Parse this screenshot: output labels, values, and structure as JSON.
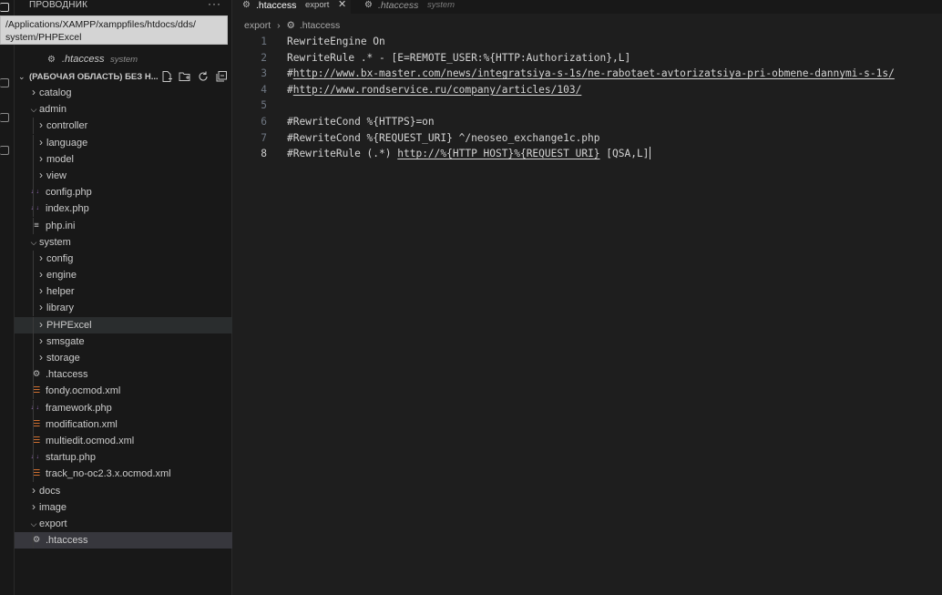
{
  "explorer": {
    "title": "ПРОВОДНИК",
    "more": "···",
    "tooltip_line1": "/Applications/XAMPP/xamppfiles/htdocs/dds/",
    "tooltip_line2": "system/PHPExcel",
    "open_editor_name": ".htaccess",
    "open_editor_desc": "system",
    "workspace_title": "(РАБОЧАЯ ОБЛАСТЬ) БЕЗ Н...",
    "tree": [
      {
        "label": "catalog",
        "kind": "folder",
        "expanded": false,
        "depth": 1
      },
      {
        "label": "admin",
        "kind": "folder",
        "expanded": true,
        "depth": 1
      },
      {
        "label": "controller",
        "kind": "folder",
        "expanded": false,
        "depth": 2
      },
      {
        "label": "language",
        "kind": "folder",
        "expanded": false,
        "depth": 2
      },
      {
        "label": "model",
        "kind": "folder",
        "expanded": false,
        "depth": 2
      },
      {
        "label": "view",
        "kind": "folder",
        "expanded": false,
        "depth": 2
      },
      {
        "label": "config.php",
        "kind": "php",
        "depth": 2
      },
      {
        "label": "index.php",
        "kind": "php",
        "depth": 2
      },
      {
        "label": "php.ini",
        "kind": "ini",
        "depth": 2
      },
      {
        "label": "system",
        "kind": "folder",
        "expanded": true,
        "depth": 1
      },
      {
        "label": "config",
        "kind": "folder",
        "expanded": false,
        "depth": 2
      },
      {
        "label": "engine",
        "kind": "folder",
        "expanded": false,
        "depth": 2
      },
      {
        "label": "helper",
        "kind": "folder",
        "expanded": false,
        "depth": 2
      },
      {
        "label": "library",
        "kind": "folder",
        "expanded": false,
        "depth": 2
      },
      {
        "label": "PHPExcel",
        "kind": "folder",
        "expanded": false,
        "depth": 2,
        "state": "hover"
      },
      {
        "label": "smsgate",
        "kind": "folder",
        "expanded": false,
        "depth": 2
      },
      {
        "label": "storage",
        "kind": "folder",
        "expanded": false,
        "depth": 2
      },
      {
        "label": ".htaccess",
        "kind": "gear",
        "depth": 2
      },
      {
        "label": "fondy.ocmod.xml",
        "kind": "xml",
        "depth": 2
      },
      {
        "label": "framework.php",
        "kind": "php",
        "depth": 2
      },
      {
        "label": "modification.xml",
        "kind": "xml",
        "depth": 2
      },
      {
        "label": "multiedit.ocmod.xml",
        "kind": "xml",
        "depth": 2
      },
      {
        "label": "startup.php",
        "kind": "php",
        "depth": 2
      },
      {
        "label": "track_no-oc2.3.x.ocmod.xml",
        "kind": "xml",
        "depth": 2
      },
      {
        "label": "docs",
        "kind": "folder",
        "expanded": false,
        "depth": 1
      },
      {
        "label": "image",
        "kind": "folder",
        "expanded": false,
        "depth": 1
      },
      {
        "label": "export",
        "kind": "folder",
        "expanded": true,
        "depth": 1
      },
      {
        "label": ".htaccess",
        "kind": "gear",
        "depth": 2,
        "state": "active"
      }
    ]
  },
  "tabs": [
    {
      "name": ".htaccess",
      "desc": "export",
      "active": true,
      "close": "✕"
    },
    {
      "name": ".htaccess",
      "desc": "system",
      "active": false
    }
  ],
  "breadcrumb": {
    "folder": "export",
    "separator": "›",
    "file": ".htaccess"
  },
  "code_lines": [
    {
      "n": "1",
      "parts": [
        {
          "t": "RewriteEngine On"
        }
      ]
    },
    {
      "n": "2",
      "parts": [
        {
          "t": "RewriteRule .* - [E=REMOTE_USER:%{HTTP:Authorization},L]"
        }
      ]
    },
    {
      "n": "3",
      "parts": [
        {
          "t": "#"
        },
        {
          "t": "http://www.bx-master.com/news/integratsiya-s-1s/ne-rabotaet-avtorizatsiya-pri-obmene-dannymi-s-1s/",
          "link": true
        }
      ]
    },
    {
      "n": "4",
      "parts": [
        {
          "t": "#"
        },
        {
          "t": "http://www.rondservice.ru/company/articles/103/",
          "link": true
        }
      ]
    },
    {
      "n": "5",
      "parts": []
    },
    {
      "n": "6",
      "parts": [
        {
          "t": "#RewriteCond %{HTTPS}=on"
        }
      ]
    },
    {
      "n": "7",
      "parts": [
        {
          "t": "#RewriteCond %{REQUEST_URI} ^/neoseo_exchange1c.php"
        }
      ]
    },
    {
      "n": "8",
      "parts": [
        {
          "t": "#RewriteRule (.*) "
        },
        {
          "t": "http://%{HTTP_HOST}%{REQUEST_URI}",
          "link": true
        },
        {
          "t": " [QSA,L]"
        }
      ],
      "current": true
    }
  ]
}
